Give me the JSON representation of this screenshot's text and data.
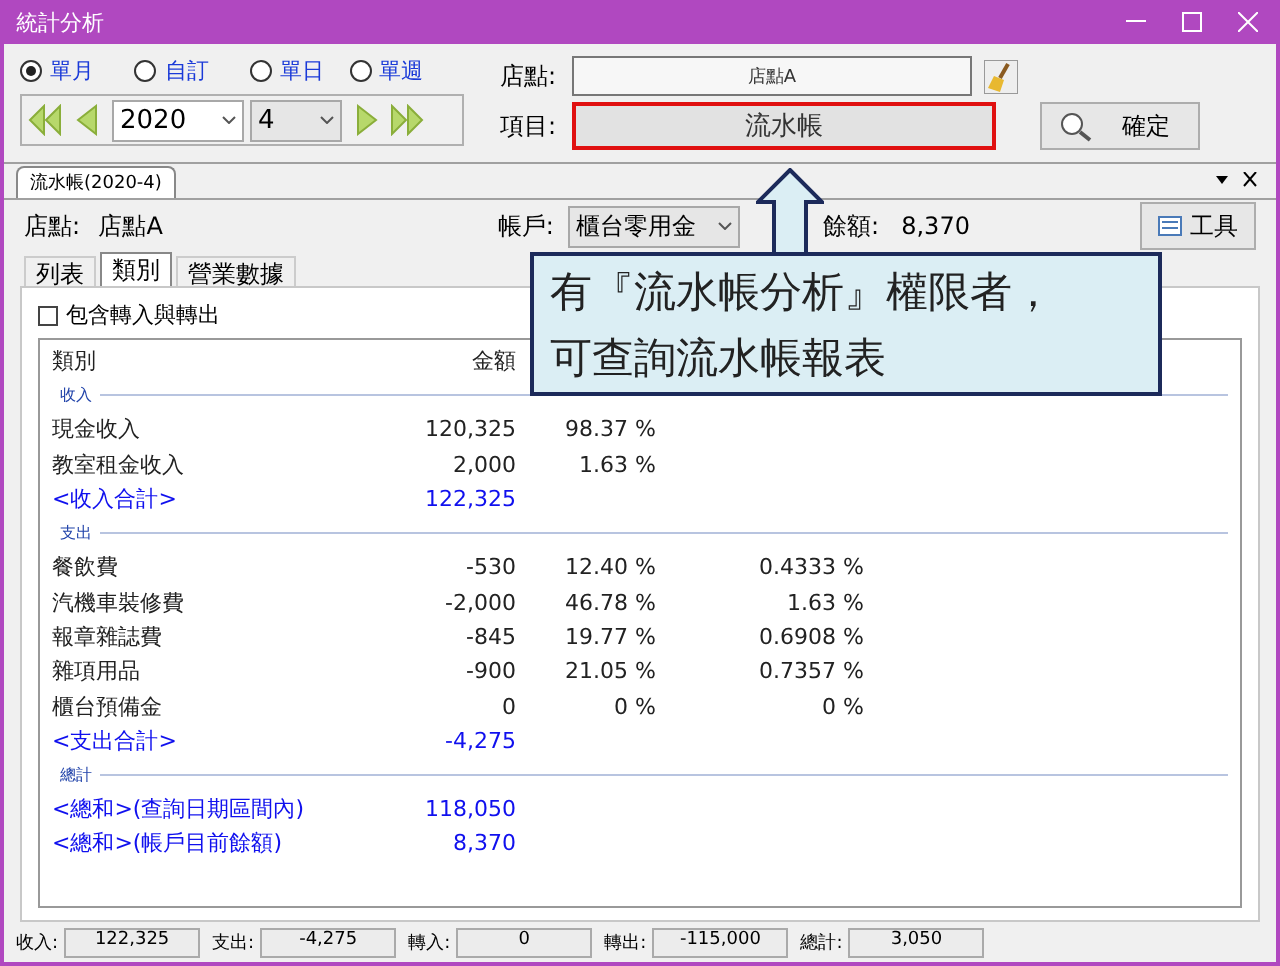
{
  "window": {
    "title": "統計分析"
  },
  "period_modes": [
    {
      "label": "單月",
      "selected": true
    },
    {
      "label": "自訂",
      "selected": false
    },
    {
      "label": "單日",
      "selected": false
    },
    {
      "label": "單週",
      "selected": false
    }
  ],
  "year": "2020",
  "month": "4",
  "store": {
    "label": "店點:",
    "value": "店點A"
  },
  "item": {
    "label": "項目:",
    "value": "流水帳"
  },
  "confirm_button": "確定",
  "document_tab": "流水帳(2020-4)",
  "info": {
    "store_label": "店點:",
    "store_value": "店點A",
    "account_label": "帳戶:",
    "account_value": "櫃台零用金",
    "balance_label": "餘額:",
    "balance_value": "8,370"
  },
  "tools_button": "工具",
  "view_tabs": [
    {
      "label": "列表",
      "selected": false
    },
    {
      "label": "類別",
      "selected": true
    },
    {
      "label": "營業數據",
      "selected": false
    }
  ],
  "include_transfers": {
    "label": "包含轉入與轉出",
    "checked": false
  },
  "table": {
    "columns": [
      "類別",
      "金額"
    ],
    "rows": [
      {
        "kind": "section",
        "name": "收入"
      },
      {
        "kind": "item",
        "name": "現金收入",
        "amount": "120,325",
        "share": "98.37 %"
      },
      {
        "kind": "item",
        "name": "教室租金收入",
        "amount": "2,000",
        "share": "1.63 %"
      },
      {
        "kind": "total",
        "name": "<收入合計>",
        "amount": "122,325"
      },
      {
        "kind": "section",
        "name": "支出"
      },
      {
        "kind": "item",
        "name": "餐飲費",
        "amount": "-530",
        "share": "12.40 %",
        "ratio": "0.4333 %"
      },
      {
        "kind": "item",
        "name": "汽機車裝修費",
        "amount": "-2,000",
        "share": "46.78 %",
        "ratio": "1.63 %"
      },
      {
        "kind": "item",
        "name": "報章雜誌費",
        "amount": "-845",
        "share": "19.77 %",
        "ratio": "0.6908 %"
      },
      {
        "kind": "item",
        "name": "雜項用品",
        "amount": "-900",
        "share": "21.05 %",
        "ratio": "0.7357 %"
      },
      {
        "kind": "item",
        "name": "櫃台預備金",
        "amount": "0",
        "share": "0 %",
        "ratio": "0 %"
      },
      {
        "kind": "total",
        "name": "<支出合計>",
        "amount": "-4,275"
      },
      {
        "kind": "section",
        "name": "總計"
      },
      {
        "kind": "total",
        "name": "<總和>(查詢日期區間內)",
        "amount": "118,050"
      },
      {
        "kind": "total",
        "name": "<總和>(帳戶目前餘額)",
        "amount": "8,370"
      }
    ]
  },
  "callout": {
    "lines": [
      "有『流水帳分析』權限者，",
      "可查詢流水帳報表"
    ]
  },
  "status_bar": [
    {
      "label": "收入:",
      "value": "122,325"
    },
    {
      "label": "支出:",
      "value": "-4,275"
    },
    {
      "label": "轉入:",
      "value": "0"
    },
    {
      "label": "轉出:",
      "value": "-115,000"
    },
    {
      "label": "總計:",
      "value": "3,050"
    }
  ]
}
